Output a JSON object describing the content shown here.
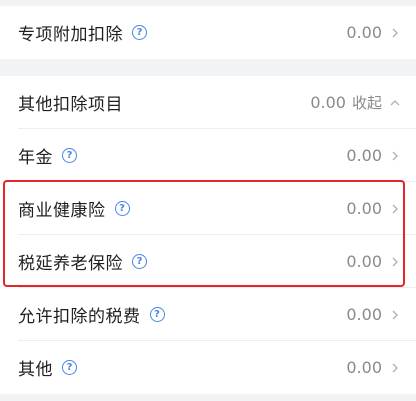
{
  "section1": {
    "item": {
      "label": "专项附加扣除",
      "value": "0.00",
      "icon": "help-icon"
    }
  },
  "section2": {
    "header": {
      "label": "其他扣除项目",
      "value": "0.00",
      "collapse_label": "收起"
    },
    "items": [
      {
        "label": "年金",
        "value": "0.00"
      },
      {
        "label": "商业健康险",
        "value": "0.00"
      },
      {
        "label": "税延养老保险",
        "value": "0.00"
      },
      {
        "label": "允许扣除的税费",
        "value": "0.00"
      },
      {
        "label": "其他",
        "value": "0.00"
      }
    ]
  },
  "colors": {
    "accent": "#4a84e8",
    "highlight": "#e5252a",
    "value": "#8a8a8a"
  },
  "help_glyph": "?"
}
